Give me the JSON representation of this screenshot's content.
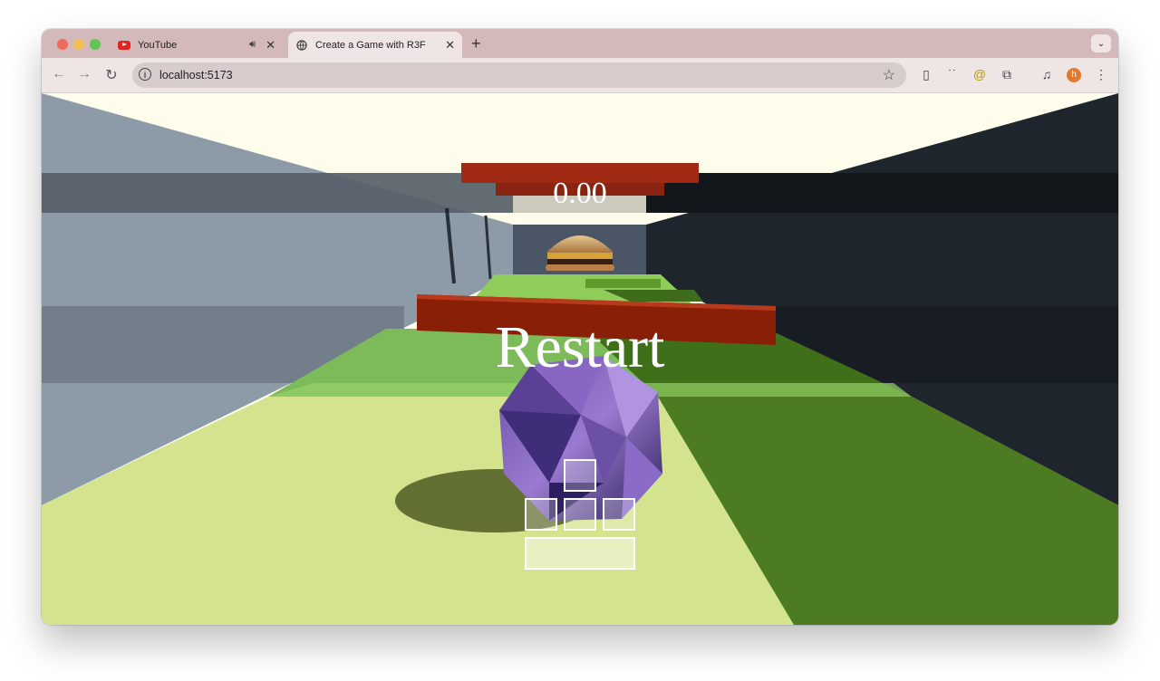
{
  "browser": {
    "tabs": [
      {
        "title": "YouTube",
        "icon": "youtube-icon",
        "audio": true
      },
      {
        "title": "Create a Game with R3F",
        "icon": "globe-icon",
        "active": true
      }
    ],
    "url": "localhost:5173",
    "avatar_initial": "h"
  },
  "game": {
    "timer": "0.00",
    "restart_label": "Restart",
    "controls": [
      "forward",
      "left",
      "backward",
      "right",
      "jump"
    ]
  },
  "colors": {
    "tabbar": "#d3b9b9",
    "floor": "#d3e38e",
    "floor_dark": "#4d7b21",
    "obstacle": "#a12a14",
    "ball": "#7c5cc0"
  }
}
